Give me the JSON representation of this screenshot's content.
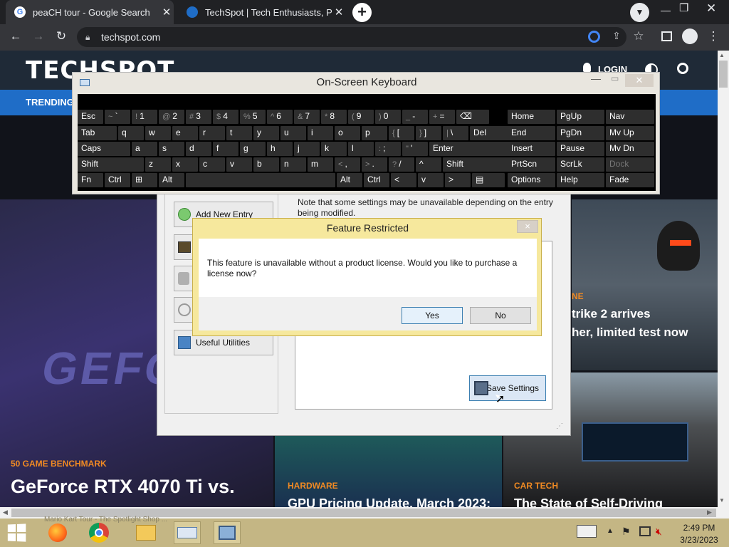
{
  "browser": {
    "tabs": [
      {
        "title": "peaCH tour - Google Search",
        "active": true
      },
      {
        "title": "TechSpot | Tech Enthusiasts, Pow",
        "active": false
      }
    ],
    "new_tab": "+",
    "url": "techspot.com"
  },
  "site": {
    "logo": "TECHSPOT",
    "login": "LOGIN",
    "trending": "TRENDING",
    "cards": [
      {
        "category": "50 GAME BENCHMARK",
        "headline": "GeForce RTX 4070 Ti vs."
      },
      {
        "category": "HARDWARE",
        "headline": "GPU Pricing Update, March 2023:"
      },
      {
        "category": "CAR TECH",
        "headline": "The State of Self-Driving"
      },
      {
        "category": "NE",
        "headline_line1": "trike 2 arrives",
        "headline_line2": "her, limited test now"
      }
    ],
    "bg_word": "GEFO"
  },
  "osk": {
    "title": "On-Screen Keyboard",
    "rows": [
      [
        {
          "l": "Esc"
        },
        {
          "l": "`",
          "s": "~"
        },
        {
          "l": "1",
          "s": "!"
        },
        {
          "l": "2",
          "s": "@"
        },
        {
          "l": "3",
          "s": "#"
        },
        {
          "l": "4",
          "s": "$"
        },
        {
          "l": "5",
          "s": "%"
        },
        {
          "l": "6",
          "s": "^"
        },
        {
          "l": "7",
          "s": "&"
        },
        {
          "l": "8",
          "s": "*"
        },
        {
          "l": "9",
          "s": "("
        },
        {
          "l": "0",
          "s": ")"
        },
        {
          "l": "-",
          "s": "_"
        },
        {
          "l": "=",
          "s": "+"
        },
        {
          "l": "⌫"
        }
      ],
      [
        {
          "l": "Tab"
        },
        {
          "l": "q"
        },
        {
          "l": "w"
        },
        {
          "l": "e"
        },
        {
          "l": "r"
        },
        {
          "l": "t"
        },
        {
          "l": "y"
        },
        {
          "l": "u"
        },
        {
          "l": "i"
        },
        {
          "l": "o"
        },
        {
          "l": "p"
        },
        {
          "l": "[",
          "s": "{"
        },
        {
          "l": "]",
          "s": "}"
        },
        {
          "l": "\\",
          "s": "|"
        },
        {
          "l": "Del"
        }
      ],
      [
        {
          "l": "Caps"
        },
        {
          "l": "a"
        },
        {
          "l": "s"
        },
        {
          "l": "d"
        },
        {
          "l": "f"
        },
        {
          "l": "g"
        },
        {
          "l": "h"
        },
        {
          "l": "j"
        },
        {
          "l": "k"
        },
        {
          "l": "l"
        },
        {
          "l": ";",
          "s": ":"
        },
        {
          "l": "'",
          "s": "\""
        },
        {
          "l": "Enter"
        }
      ],
      [
        {
          "l": "Shift"
        },
        {
          "l": "z"
        },
        {
          "l": "x"
        },
        {
          "l": "c"
        },
        {
          "l": "v"
        },
        {
          "l": "b"
        },
        {
          "l": "n"
        },
        {
          "l": "m"
        },
        {
          "l": ",",
          "s": "<"
        },
        {
          "l": ".",
          "s": ">"
        },
        {
          "l": "/",
          "s": "?"
        },
        {
          "l": "^"
        },
        {
          "l": "Shift"
        }
      ],
      [
        {
          "l": "Fn"
        },
        {
          "l": "Ctrl"
        },
        {
          "l": "⊞"
        },
        {
          "l": "Alt"
        },
        {
          "l": ""
        },
        {
          "l": "Alt"
        },
        {
          "l": "Ctrl"
        },
        {
          "l": "<"
        },
        {
          "l": "v"
        },
        {
          "l": ">"
        },
        {
          "l": "▤"
        }
      ]
    ],
    "nav_rows": [
      [
        "Home",
        "PgUp",
        "Nav"
      ],
      [
        "End",
        "PgDn",
        "Mv Up"
      ],
      [
        "Insert",
        "Pause",
        "Mv Dn"
      ],
      [
        "PrtScn",
        "ScrLk",
        "Dock"
      ],
      [
        "Options",
        "Help",
        "Fade"
      ]
    ]
  },
  "app": {
    "note": "Note that some settings may be unavailable depending on the entry being modified.",
    "sidebar": [
      "Add New Entry",
      "",
      "",
      "",
      "Useful Utilities"
    ],
    "save_label": "Save Settings"
  },
  "dialog": {
    "title": "Feature Restricted",
    "close": "×",
    "message": "This feature is unavailable without a product license. Would you like to purchase a license now?",
    "yes": "Yes",
    "no": "No"
  },
  "taskbar": {
    "time": "2:49 PM",
    "date": "3/23/2023",
    "faint_text": "Mario Kart Tour - The Spotlight Shop ..."
  },
  "colors": {
    "accent": "#1f6dc7",
    "category": "#f08a23",
    "dialog": "#f6e89d"
  }
}
